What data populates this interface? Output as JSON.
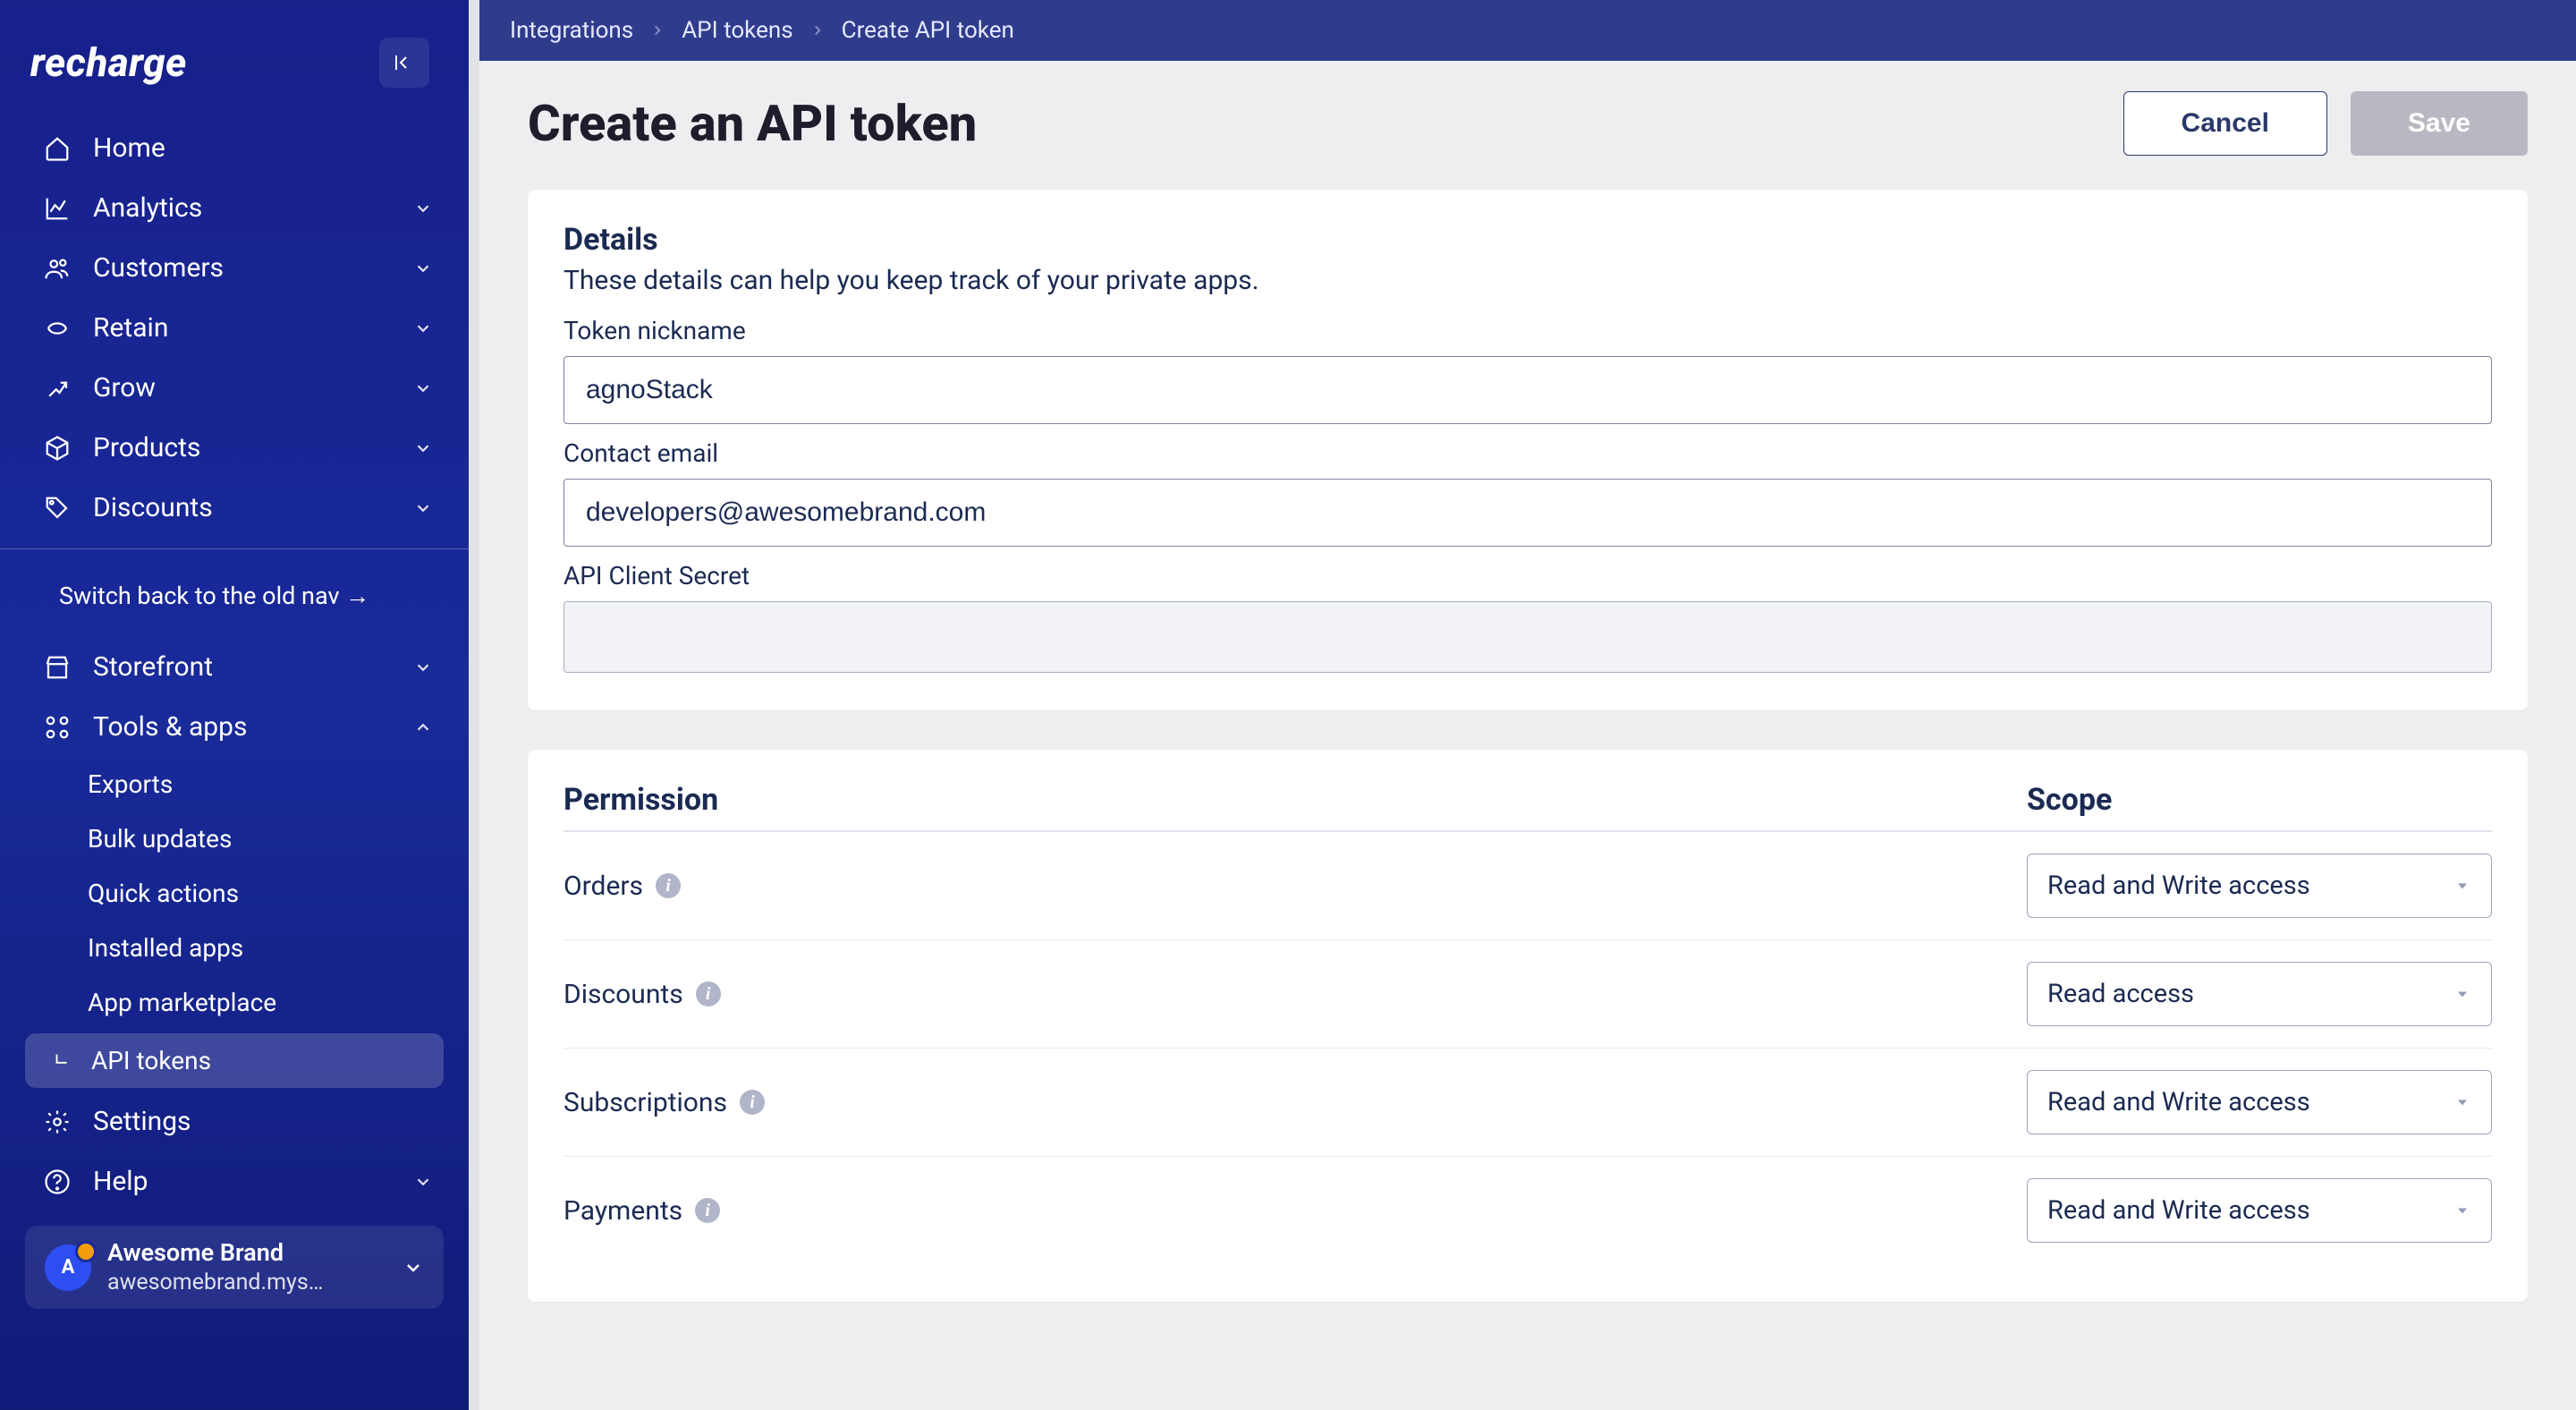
{
  "brand": "recharge",
  "sidebar": {
    "items": {
      "home": {
        "label": "Home"
      },
      "analytics": {
        "label": "Analytics"
      },
      "customers": {
        "label": "Customers"
      },
      "retain": {
        "label": "Retain"
      },
      "grow": {
        "label": "Grow"
      },
      "products": {
        "label": "Products"
      },
      "discounts": {
        "label": "Discounts"
      },
      "storefront": {
        "label": "Storefront"
      },
      "tools": {
        "label": "Tools & apps"
      },
      "settings": {
        "label": "Settings"
      },
      "help": {
        "label": "Help"
      }
    },
    "switch_old": "Switch back to the old nav  →",
    "tools_children": {
      "exports": "Exports",
      "bulk_updates": "Bulk updates",
      "quick_actions": "Quick actions",
      "installed_apps": "Installed apps",
      "marketplace": "App marketplace",
      "api_tokens": "API tokens"
    },
    "store": {
      "initial": "A",
      "name": "Awesome Brand",
      "url": "awesomebrand.mys…"
    }
  },
  "breadcrumbs": {
    "a": "Integrations",
    "b": "API tokens",
    "c": "Create API token"
  },
  "page": {
    "title": "Create an API token",
    "cancel": "Cancel",
    "save": "Save"
  },
  "details": {
    "heading": "Details",
    "sub": "These details can help you keep track of your private apps.",
    "nickname_label": "Token nickname",
    "nickname_value": "agnoStack",
    "email_label": "Contact email",
    "email_value": "developers@awesomebrand.com",
    "secret_label": "API Client Secret"
  },
  "perm": {
    "col1": "Permission",
    "col2": "Scope",
    "rows": {
      "orders": {
        "name": "Orders",
        "scope": "Read and Write access"
      },
      "discounts": {
        "name": "Discounts",
        "scope": "Read access"
      },
      "subscriptions": {
        "name": "Subscriptions",
        "scope": "Read and Write access"
      },
      "payments": {
        "name": "Payments",
        "scope": "Read and Write access"
      }
    }
  }
}
